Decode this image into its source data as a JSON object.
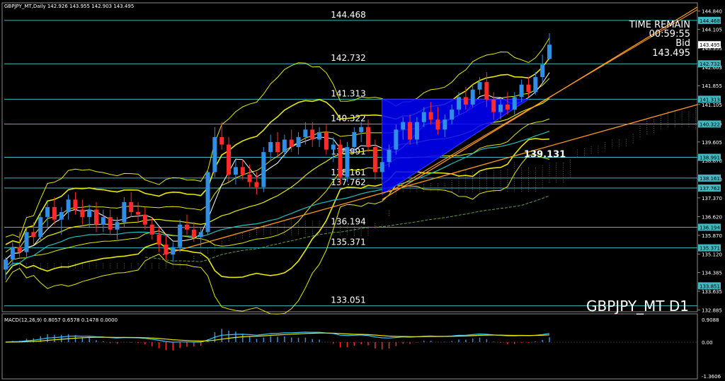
{
  "window": {
    "header": "GBPJPY_MT,Daily  142.926 143.955 142.903 143.495",
    "symbol_watermark": "GBPJPY_MT D1",
    "timer_label": "TIME REMAIN",
    "timer_value": "00:59:55",
    "bid_label": "Bid",
    "bid_value": "143.495",
    "macd_header": "MACD(12,26,9) 0.8057 0.6578 0.1478 0.0000"
  },
  "colors": {
    "background": "#000000",
    "up_candle": "#2f8fe6",
    "down_candle": "#ff2a2a",
    "bollinger": "#e8e800",
    "level_line": "#3fb8c0",
    "trendline": "#ff9a1a",
    "triangle": "#0000ff",
    "macd_line": "#37c8ff",
    "signal_line": "#e8e800"
  },
  "chart_data": [
    {
      "type": "candlestick",
      "title": "GBPJPY_MT D1",
      "ylim": [
        132.9,
        145.0
      ],
      "y_ticks": [
        "144.840",
        "144.105",
        "143.355",
        "142.603",
        "141.855",
        "141.105",
        "140.355",
        "139.605",
        "138.870",
        "138.120",
        "137.370",
        "136.620",
        "135.870",
        "135.120",
        "134.385",
        "133.635",
        "132.885"
      ],
      "price_tags": [
        "144.468",
        "143.495",
        "142.732",
        "141.313",
        "140.322",
        "138.991",
        "138.161",
        "137.762",
        "136.194",
        "135.371",
        "133.851"
      ],
      "levels": [
        {
          "label": "144.468",
          "value": 144.468
        },
        {
          "label": "142.732",
          "value": 142.732
        },
        {
          "label": "141.313",
          "value": 141.313
        },
        {
          "label": "140.322",
          "value": 140.322
        },
        {
          "label": "138.991",
          "value": 138.991
        },
        {
          "label": "138.161",
          "value": 138.161
        },
        {
          "label": "137.762",
          "value": 137.762
        },
        {
          "label": "136.194",
          "value": 136.194
        },
        {
          "label": "135.371",
          "value": 135.371
        },
        {
          "label": "133.051",
          "value": 133.051
        }
      ],
      "annotation": "139.131",
      "series_ohlc": [
        [
          134.5,
          135.0,
          134.1,
          134.9
        ],
        [
          134.9,
          135.6,
          134.6,
          135.4
        ],
        [
          135.4,
          136.0,
          135.0,
          135.2
        ],
        [
          135.2,
          136.2,
          135.0,
          136.0
        ],
        [
          136.0,
          136.4,
          135.5,
          135.8
        ],
        [
          135.8,
          136.8,
          135.6,
          136.6
        ],
        [
          136.6,
          137.2,
          136.2,
          137.0
        ],
        [
          137.0,
          137.4,
          136.3,
          136.5
        ],
        [
          136.5,
          137.0,
          135.9,
          136.8
        ],
        [
          136.8,
          137.5,
          136.5,
          137.3
        ],
        [
          137.3,
          137.6,
          136.7,
          136.9
        ],
        [
          136.9,
          137.3,
          136.3,
          136.6
        ],
        [
          136.6,
          137.1,
          136.2,
          136.9
        ],
        [
          136.9,
          137.2,
          136.0,
          136.3
        ],
        [
          136.3,
          136.9,
          136.0,
          136.6
        ],
        [
          136.6,
          136.9,
          135.9,
          136.1
        ],
        [
          136.1,
          136.6,
          135.7,
          136.4
        ],
        [
          136.4,
          137.4,
          136.2,
          137.2
        ],
        [
          137.2,
          137.6,
          136.6,
          136.8
        ],
        [
          136.8,
          137.2,
          136.4,
          136.7
        ],
        [
          136.7,
          137.0,
          136.1,
          136.3
        ],
        [
          136.3,
          136.6,
          135.7,
          135.9
        ],
        [
          135.9,
          136.2,
          135.2,
          135.5
        ],
        [
          135.5,
          135.9,
          134.9,
          135.1
        ],
        [
          135.1,
          135.6,
          134.8,
          135.4
        ],
        [
          135.4,
          136.5,
          135.2,
          136.3
        ],
        [
          136.3,
          136.7,
          135.9,
          136.1
        ],
        [
          136.1,
          136.4,
          135.6,
          135.8
        ],
        [
          135.8,
          136.2,
          135.4,
          136.0
        ],
        [
          136.0,
          138.5,
          135.9,
          138.4
        ],
        [
          138.4,
          140.2,
          138.2,
          139.8
        ],
        [
          139.8,
          140.4,
          139.3,
          139.5
        ],
        [
          139.5,
          139.8,
          138.0,
          138.3
        ],
        [
          138.3,
          138.9,
          137.9,
          138.6
        ],
        [
          138.6,
          138.9,
          138.1,
          138.3
        ],
        [
          138.3,
          138.7,
          137.8,
          138.0
        ],
        [
          138.0,
          138.4,
          137.5,
          137.8
        ],
        [
          137.8,
          139.4,
          137.6,
          139.2
        ],
        [
          139.2,
          139.9,
          138.9,
          139.6
        ],
        [
          139.6,
          140.0,
          139.0,
          139.2
        ],
        [
          139.2,
          139.9,
          139.0,
          139.7
        ],
        [
          139.7,
          140.1,
          139.2,
          139.4
        ],
        [
          139.4,
          140.0,
          139.1,
          139.8
        ],
        [
          139.8,
          140.4,
          139.5,
          140.1
        ],
        [
          140.1,
          140.4,
          139.4,
          139.7
        ],
        [
          139.7,
          140.2,
          139.4,
          140.0
        ],
        [
          140.0,
          140.3,
          139.1,
          139.3
        ],
        [
          139.3,
          139.8,
          138.8,
          139.5
        ],
        [
          139.5,
          139.7,
          137.9,
          138.2
        ],
        [
          138.2,
          139.6,
          138.0,
          139.4
        ],
        [
          139.4,
          140.2,
          139.2,
          140.0
        ],
        [
          140.0,
          140.4,
          139.6,
          140.2
        ],
        [
          140.2,
          140.5,
          139.2,
          139.4
        ],
        [
          139.4,
          139.7,
          138.1,
          138.4
        ],
        [
          138.4,
          139.0,
          138.1,
          138.8
        ],
        [
          138.8,
          139.5,
          138.6,
          139.3
        ],
        [
          139.3,
          140.3,
          139.1,
          140.1
        ],
        [
          140.1,
          140.6,
          139.7,
          140.4
        ],
        [
          140.4,
          140.7,
          139.5,
          139.7
        ],
        [
          139.7,
          140.6,
          139.5,
          140.4
        ],
        [
          140.4,
          141.0,
          140.2,
          140.8
        ],
        [
          140.8,
          141.2,
          140.3,
          140.5
        ],
        [
          140.5,
          141.0,
          139.9,
          140.1
        ],
        [
          140.1,
          140.7,
          139.8,
          140.5
        ],
        [
          140.5,
          141.1,
          140.3,
          140.9
        ],
        [
          140.9,
          141.6,
          140.7,
          141.4
        ],
        [
          141.4,
          141.8,
          140.9,
          141.1
        ],
        [
          141.1,
          141.9,
          141.0,
          141.7
        ],
        [
          141.7,
          142.2,
          141.5,
          142.0
        ],
        [
          142.0,
          142.4,
          141.0,
          141.3
        ],
        [
          141.3,
          141.6,
          140.5,
          140.8
        ],
        [
          140.8,
          141.3,
          140.5,
          141.1
        ],
        [
          141.1,
          141.6,
          140.7,
          140.9
        ],
        [
          140.9,
          141.6,
          140.7,
          141.4
        ],
        [
          141.4,
          142.1,
          141.2,
          141.9
        ],
        [
          141.9,
          142.2,
          141.4,
          141.6
        ],
        [
          141.6,
          142.4,
          141.5,
          142.2
        ],
        [
          142.2,
          143.1,
          142.0,
          142.7
        ],
        [
          142.926,
          143.955,
          142.903,
          143.495
        ]
      ],
      "macd": {
        "y_ticks": [
          "0.9088",
          "0.00",
          "-1.3606"
        ],
        "ylim": [
          -1.3606,
          0.9088
        ]
      }
    }
  ]
}
